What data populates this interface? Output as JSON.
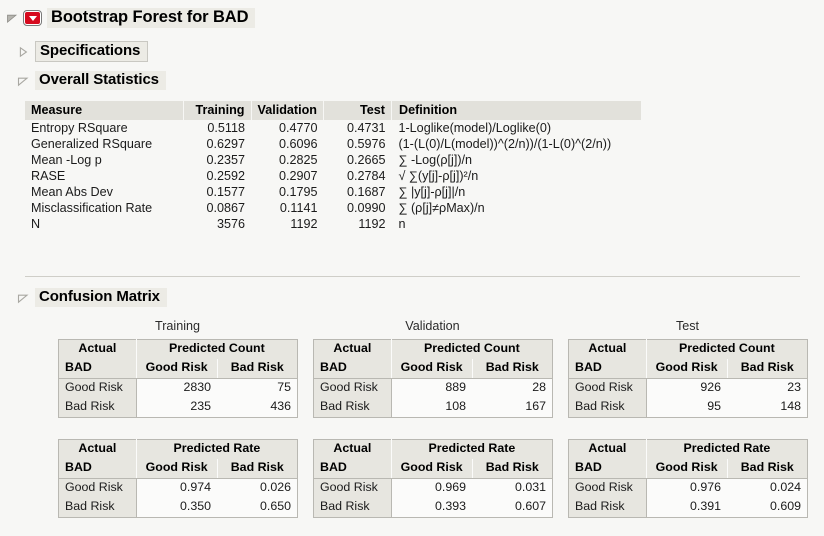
{
  "panel": {
    "title": "Bootstrap Forest for BAD",
    "menu_icon": "red-triangle-menu-icon",
    "disclosure_open_icon": "disclosure-triangle-open-icon",
    "disclosure_closed_icon": "disclosure-triangle-closed-icon"
  },
  "sections": {
    "specifications": {
      "title": "Specifications",
      "expanded": false
    },
    "overall_statistics": {
      "title": "Overall Statistics",
      "expanded": true
    },
    "confusion_matrix": {
      "title": "Confusion Matrix",
      "expanded": true
    }
  },
  "overall_statistics": {
    "columns": [
      "Measure",
      "Training",
      "Validation",
      "Test",
      "Definition"
    ],
    "rows": [
      {
        "measure": "Entropy RSquare",
        "training": "0.5118",
        "validation": "0.4770",
        "test": "0.4731",
        "definition": "1-Loglike(model)/Loglike(0)"
      },
      {
        "measure": "Generalized RSquare",
        "training": "0.6297",
        "validation": "0.6096",
        "test": "0.5976",
        "definition": "(1-(L(0)/L(model))^(2/n))/(1-L(0)^(2/n))"
      },
      {
        "measure": "Mean -Log p",
        "training": "0.2357",
        "validation": "0.2825",
        "test": "0.2665",
        "definition": "∑ -Log(ρ[j])/n"
      },
      {
        "measure": "RASE",
        "training": "0.2592",
        "validation": "0.2907",
        "test": "0.2784",
        "definition": "√ ∑(y[j]-ρ[j])²/n"
      },
      {
        "measure": "Mean Abs Dev",
        "training": "0.1577",
        "validation": "0.1795",
        "test": "0.1687",
        "definition": "∑ |y[j]-ρ[j]|/n"
      },
      {
        "measure": "Misclassification Rate",
        "training": "0.0867",
        "validation": "0.1141",
        "test": "0.0990",
        "definition": "∑ (ρ[j]≠ρMax)/n"
      },
      {
        "measure": "N",
        "training": "3576",
        "validation": "1192",
        "test": "1192",
        "definition": "n"
      }
    ]
  },
  "confusion_matrix": {
    "group_labels": [
      "Training",
      "Validation",
      "Test"
    ],
    "actual_header": "Actual",
    "actual_sub": "BAD",
    "count_header": "Predicted Count",
    "rate_header": "Predicted Rate",
    "col_headers": [
      "Good Risk",
      "Bad Risk"
    ],
    "row_labels": [
      "Good Risk",
      "Bad Risk"
    ],
    "counts": {
      "training": {
        "good_good": "2830",
        "good_bad": "75",
        "bad_good": "235",
        "bad_bad": "436"
      },
      "validation": {
        "good_good": "889",
        "good_bad": "28",
        "bad_good": "108",
        "bad_bad": "167"
      },
      "test": {
        "good_good": "926",
        "good_bad": "23",
        "bad_good": "95",
        "bad_bad": "148"
      }
    },
    "rates": {
      "training": {
        "good_good": "0.974",
        "good_bad": "0.026",
        "bad_good": "0.350",
        "bad_bad": "0.650"
      },
      "validation": {
        "good_good": "0.969",
        "good_bad": "0.031",
        "bad_good": "0.393",
        "bad_bad": "0.607"
      },
      "test": {
        "good_good": "0.976",
        "good_bad": "0.024",
        "bad_good": "0.391",
        "bad_bad": "0.609"
      }
    }
  },
  "colors": {
    "background": "#f7f7f5",
    "header_fill": "#e2e1db",
    "title_band": "#ecebe5",
    "accent_red": "#d60a1e",
    "border": "#b9b8b2"
  }
}
